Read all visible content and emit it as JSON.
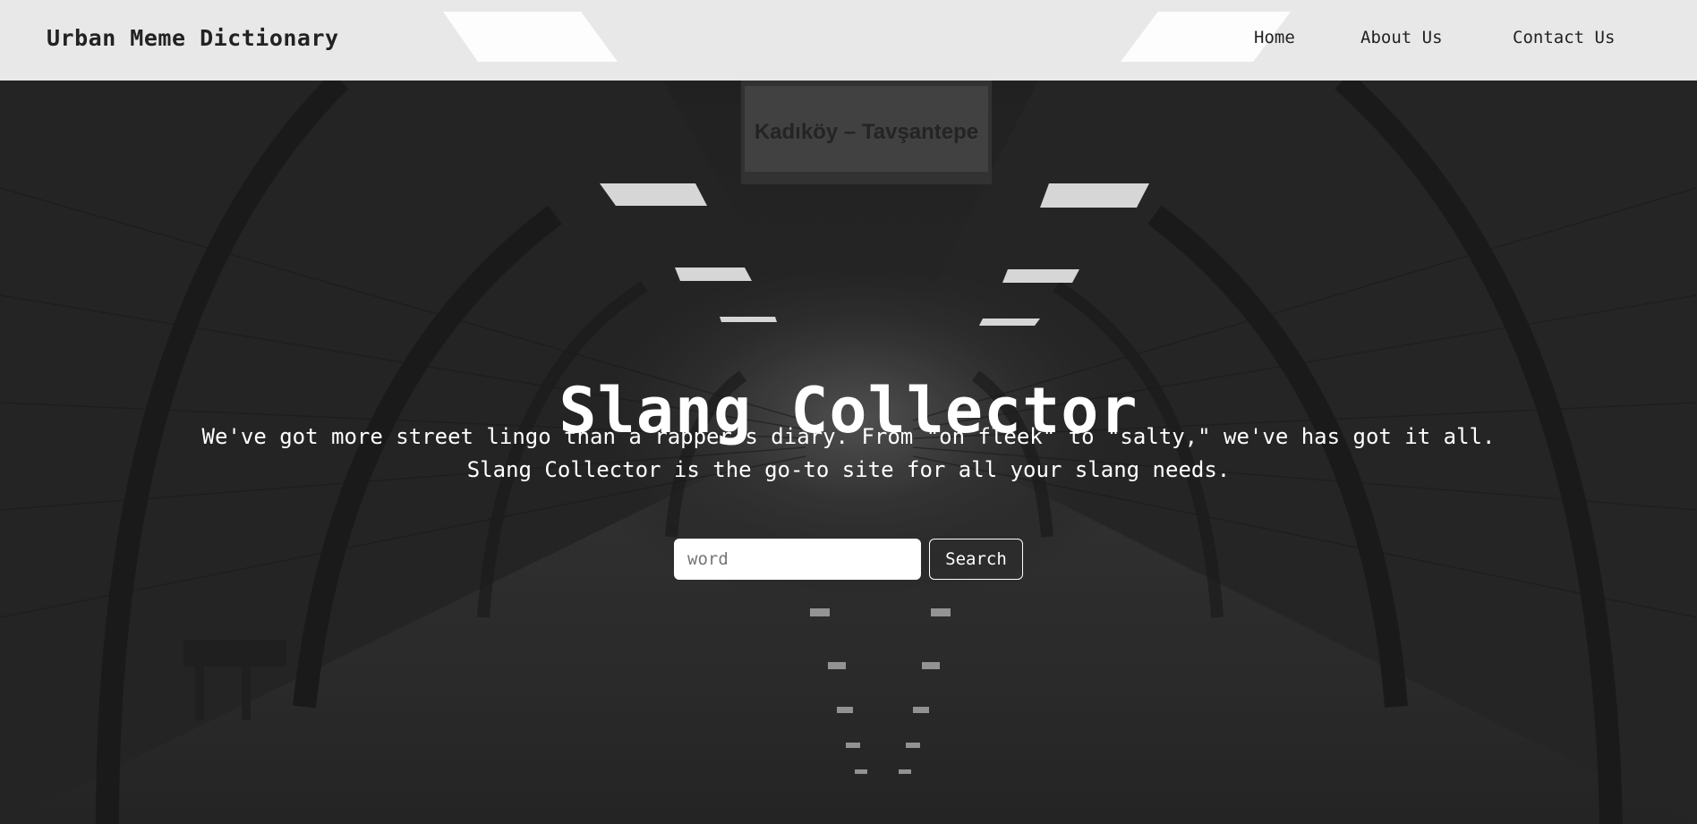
{
  "navbar": {
    "brand": "Urban Meme Dictionary",
    "links": [
      {
        "label": "Home"
      },
      {
        "label": "About Us"
      },
      {
        "label": "Contact Us"
      }
    ]
  },
  "hero": {
    "title": "Slang Collector",
    "description_line1": "We've got more street lingo than a rapper's diary. From \"on fleek\" to \"salty,\" we've has got it all.",
    "description_line2": "Slang Collector is the go-to site for all your slang needs.",
    "background_sign": "Kadıköy – Tavşantepe"
  },
  "search": {
    "placeholder": "word",
    "value": "",
    "button_label": "Search"
  }
}
